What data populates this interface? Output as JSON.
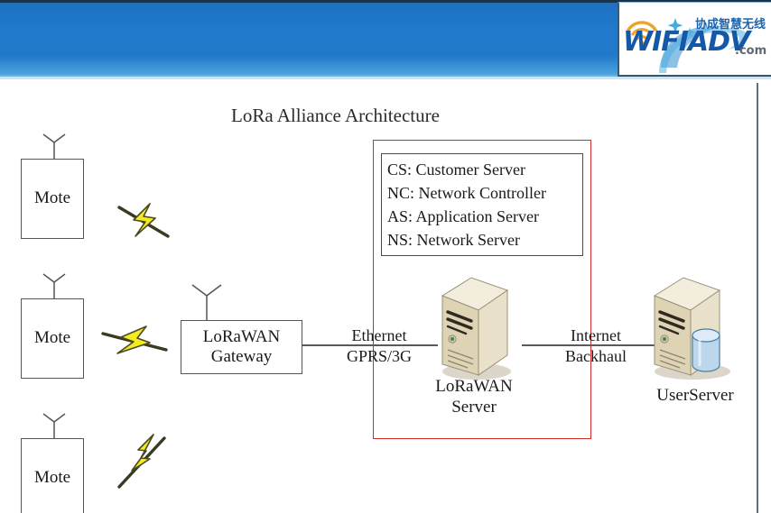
{
  "header": {
    "logo": {
      "wordmark": "WIFIADV",
      "dotcom": ".com",
      "chinese_text": "协成智慧无线",
      "wifi_icon_name": "wifi-signal-icon",
      "brand_blue": "#1558a8",
      "accent_orange": "#f0a32a"
    },
    "bar_color": "#2079cc"
  },
  "diagram": {
    "title": "LoRa Alliance Architecture",
    "motes": [
      {
        "label": "Mote"
      },
      {
        "label": "Mote"
      },
      {
        "label": "Mote"
      }
    ],
    "gateway": {
      "line1": "LoRaWAN",
      "line2": "Gateway"
    },
    "legend": {
      "lines": [
        "CS: Customer Server",
        "NC: Network Controller",
        "AS: Application Server",
        "NS: Network Server"
      ],
      "highlight_color": "#d22b2b"
    },
    "links": [
      {
        "id": "gateway-to-server",
        "line1": "Ethernet",
        "line2": "GPRS/3G"
      },
      {
        "id": "server-to-userserver",
        "line1": "Internet",
        "line2": "Backhaul"
      }
    ],
    "servers": [
      {
        "id": "lorawan-server",
        "caption_line1": "LoRaWAN",
        "caption_line2": "Server",
        "has_database": false
      },
      {
        "id": "user-server",
        "caption_line1": "UserServer",
        "caption_line2": "",
        "has_database": true
      }
    ],
    "wireless_links": [
      {
        "id": "mote-1-rf",
        "icon": "lightning-bolt-icon"
      },
      {
        "id": "mote-2-rf",
        "icon": "lightning-bolt-icon"
      },
      {
        "id": "mote-3-rf",
        "icon": "lightning-bolt-icon"
      }
    ],
    "colors": {
      "server_body": "#e8dfc4",
      "server_top": "#f3eddd",
      "server_side": "#cfc3a0",
      "database_blue": "#a8c9e4",
      "bolt_yellow": "#f5ec20",
      "line_gray": "#5a5a5a"
    }
  }
}
